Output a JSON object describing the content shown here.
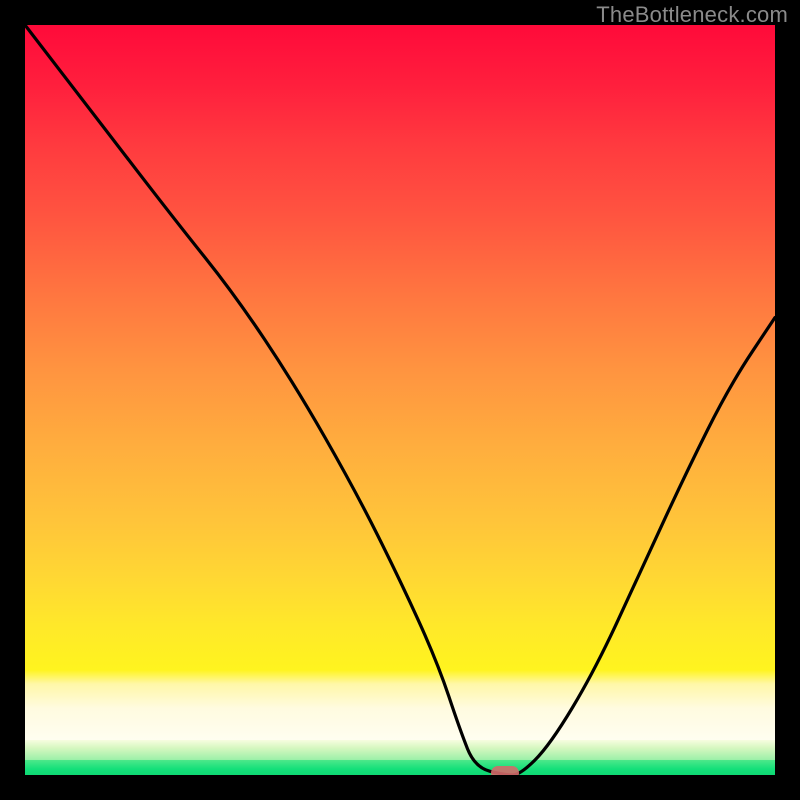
{
  "watermark": "TheBottleneck.com",
  "chart_data": {
    "type": "line",
    "title": "",
    "xlabel": "",
    "ylabel": "",
    "xlim": [
      0,
      100
    ],
    "ylim": [
      0,
      100
    ],
    "grid": false,
    "legend": false,
    "background": {
      "kind": "vertical-gradient",
      "stops": [
        {
          "pos": 0,
          "color": "#ff0a3a"
        },
        {
          "pos": 30,
          "color": "#ff5640"
        },
        {
          "pos": 60,
          "color": "#ffc43a"
        },
        {
          "pos": 82,
          "color": "#fff41f"
        },
        {
          "pos": 90,
          "color": "#fffbe0"
        },
        {
          "pos": 96,
          "color": "#9bf0a8"
        },
        {
          "pos": 100,
          "color": "#0fd874"
        }
      ]
    },
    "series": [
      {
        "name": "bottleneck-curve",
        "color": "#000000",
        "x": [
          0,
          10,
          20,
          28,
          36,
          44,
          50,
          55,
          58,
          60,
          64,
          66,
          70,
          76,
          82,
          88,
          94,
          100
        ],
        "y": [
          100,
          87,
          74,
          64,
          52,
          38,
          26,
          15,
          6,
          1,
          0,
          0,
          4,
          14,
          27,
          40,
          52,
          61
        ]
      }
    ],
    "marker": {
      "name": "optimal-point",
      "x": 64,
      "y": 0,
      "color": "#d46a6a",
      "shape": "pill"
    }
  }
}
